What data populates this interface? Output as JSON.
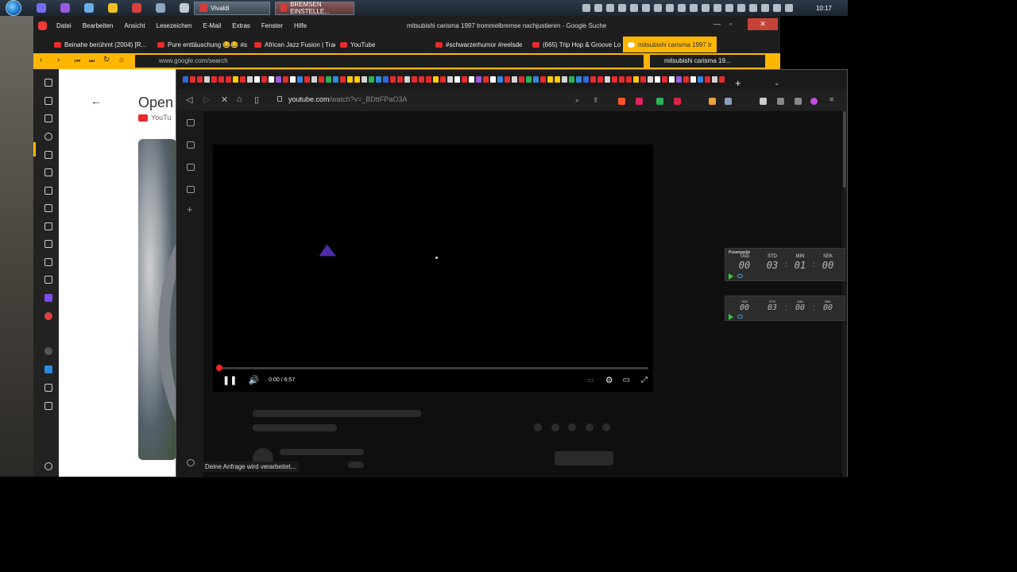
{
  "taskbar": {
    "tasks": [
      {
        "label": "Vivaldi"
      },
      {
        "label": "BREMSEN EINSTELLE..."
      }
    ],
    "clock": "10:17"
  },
  "vivaldi": {
    "menu": [
      "Datei",
      "Bearbeiten",
      "Ansicht",
      "Lesezeichen",
      "E-Mail",
      "Extras",
      "Fenster",
      "Hilfe"
    ],
    "window_title": "mitsubishi carisma 1997 trommelbremse nachjustieren - Google Suche",
    "tabs": [
      "Beinahe berühmt (2004) [R...",
      "Pure enttäuschung 😂😂 #s",
      "African Jazz Fusion | Traditi",
      "YouTube",
      "#schwarzerhumor #reelsde",
      "(665) Trip Hop & Groove Lo",
      "mitsubishi carisma 1997 tr"
    ],
    "address": "www.google.com/search",
    "bookmark": "mitsubishi carisma 19...",
    "page": {
      "open_text": "Open",
      "source": "YouTu"
    }
  },
  "brave": {
    "url_host": "youtube.com",
    "url_path": "/watch?v=_BDttFPaO3A",
    "player": {
      "time": "0:00 / 6:57",
      "progress_fraction": 0.005
    },
    "status_text": "Deine Anfrage wird verarbeitet..."
  },
  "countdowns": [
    {
      "title": "Pussenseite",
      "units": [
        "TAG",
        "STD",
        "MIN",
        "SEK"
      ],
      "values": [
        "00",
        "03",
        "01",
        "00"
      ]
    },
    {
      "title": "",
      "units": [
        "TAG",
        "STD",
        "MIN",
        "SEK"
      ],
      "values": [
        "00",
        "03",
        "00",
        "00"
      ]
    }
  ],
  "colors": {
    "vivaldi_accent": "#ffb600",
    "youtube_red": "#ff2020",
    "brave_bg": "#0f0f0f"
  }
}
